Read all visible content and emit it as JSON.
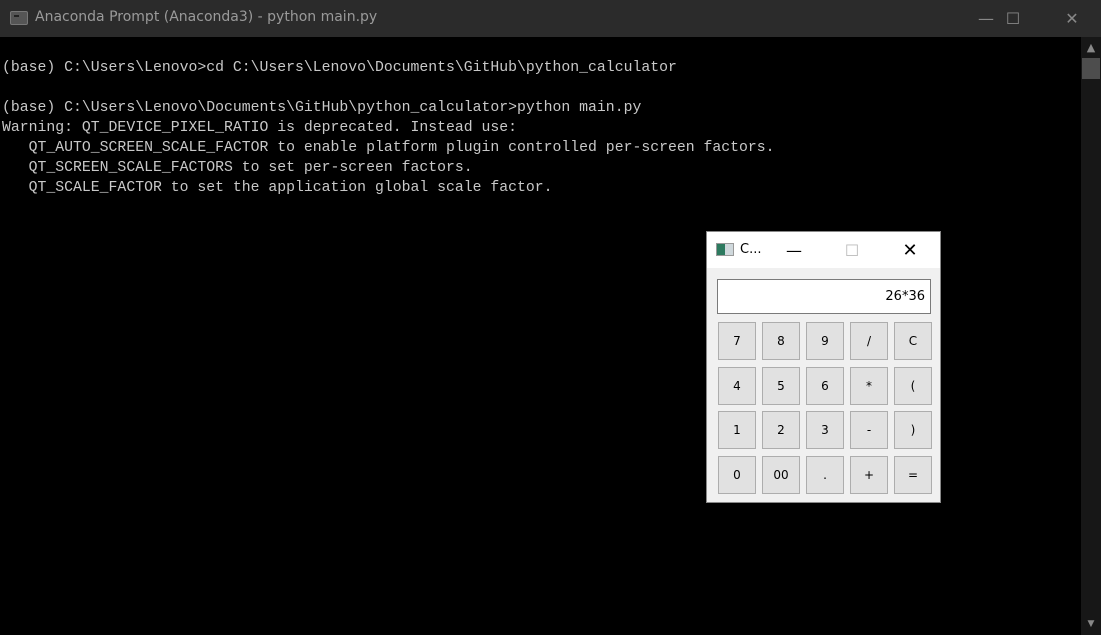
{
  "window": {
    "title": "Anaconda Prompt (Anaconda3) - python  main.py",
    "minimize": "—",
    "maximize": "☐",
    "close": "✕"
  },
  "terminal": {
    "lines": [
      "(base) C:\\Users\\Lenovo>cd C:\\Users\\Lenovo\\Documents\\GitHub\\python_calculator",
      "",
      "(base) C:\\Users\\Lenovo\\Documents\\GitHub\\python_calculator>python main.py",
      "Warning: QT_DEVICE_PIXEL_RATIO is deprecated. Instead use:",
      "   QT_AUTO_SCREEN_SCALE_FACTOR to enable platform plugin controlled per-screen factors.",
      "   QT_SCREEN_SCALE_FACTORS to set per-screen factors.",
      "   QT_SCALE_FACTOR to set the application global scale factor."
    ]
  },
  "calculator": {
    "title": "C...",
    "minimize": "—",
    "maximize": "☐",
    "close": "✕",
    "display": "26*36",
    "keys": [
      [
        "7",
        "8",
        "9",
        "/",
        "C"
      ],
      [
        "4",
        "5",
        "6",
        "*",
        "("
      ],
      [
        "1",
        "2",
        "3",
        "-",
        ")"
      ],
      [
        "0",
        "00",
        ".",
        "+",
        "="
      ]
    ]
  }
}
